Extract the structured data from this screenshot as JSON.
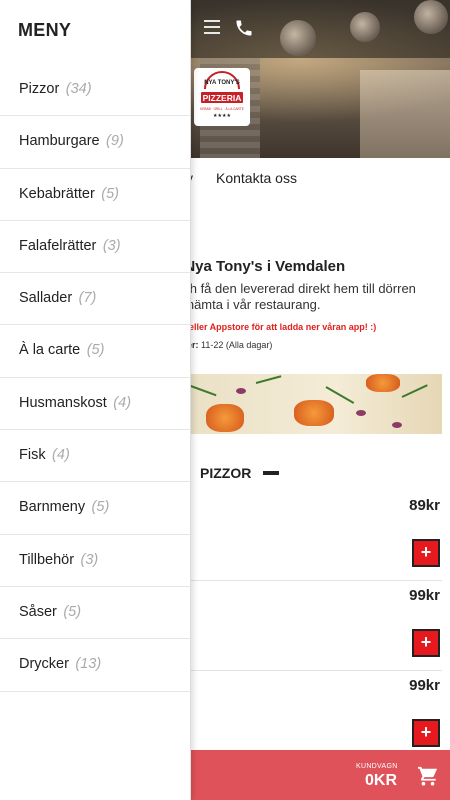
{
  "menu": {
    "title": "MENY",
    "items": [
      {
        "label": "Pizzor",
        "count": "(34)"
      },
      {
        "label": "Hamburgare",
        "count": "(9)"
      },
      {
        "label": "Kebabrätter",
        "count": "(5)"
      },
      {
        "label": "Falafelrätter",
        "count": "(3)"
      },
      {
        "label": "Sallader",
        "count": "(7)"
      },
      {
        "label": "À la carte",
        "count": "(5)"
      },
      {
        "label": "Husmanskost",
        "count": "(4)"
      },
      {
        "label": "Fisk",
        "count": "(4)"
      },
      {
        "label": "Barnmeny",
        "count": "(5)"
      },
      {
        "label": "Tillbehör",
        "count": "(3)"
      },
      {
        "label": "Såser",
        "count": "(5)"
      },
      {
        "label": "Drycker",
        "count": "(13)"
      }
    ]
  },
  "page": {
    "nav_partial": "y",
    "nav_contact": "Kontakta oss",
    "welcome": "l Nya Tony's i Vemdalen",
    "desc_line1": "och få den levererad direkt hem till dörren",
    "desc_line2": "tt hämta i vår restaurang.",
    "app_note": "ny eller Appstore för att ladda ner våran app! :)",
    "hours_label": "tider:",
    "hours_value": "11-22 (Alla dagar)",
    "logo_text_top": "NYA TONY'S",
    "logo_text_main": "PIZZERIA",
    "logo_text_sub": "KEBAB · GRILL · À LA CARTE",
    "section_title": "PIZZOR",
    "prices": [
      "89kr",
      "99kr",
      "99kr"
    ],
    "add_symbol": "+"
  },
  "cart": {
    "label": "KUNDVAGN",
    "total": "0KR"
  },
  "colors": {
    "accent": "#e5191e",
    "cart_bar": "#e0525a",
    "muted_count": "#aaaaaa"
  },
  "icons": {
    "menu": "hamburger-icon",
    "phone": "phone-icon",
    "cart": "cart-icon",
    "add": "plus-icon"
  }
}
